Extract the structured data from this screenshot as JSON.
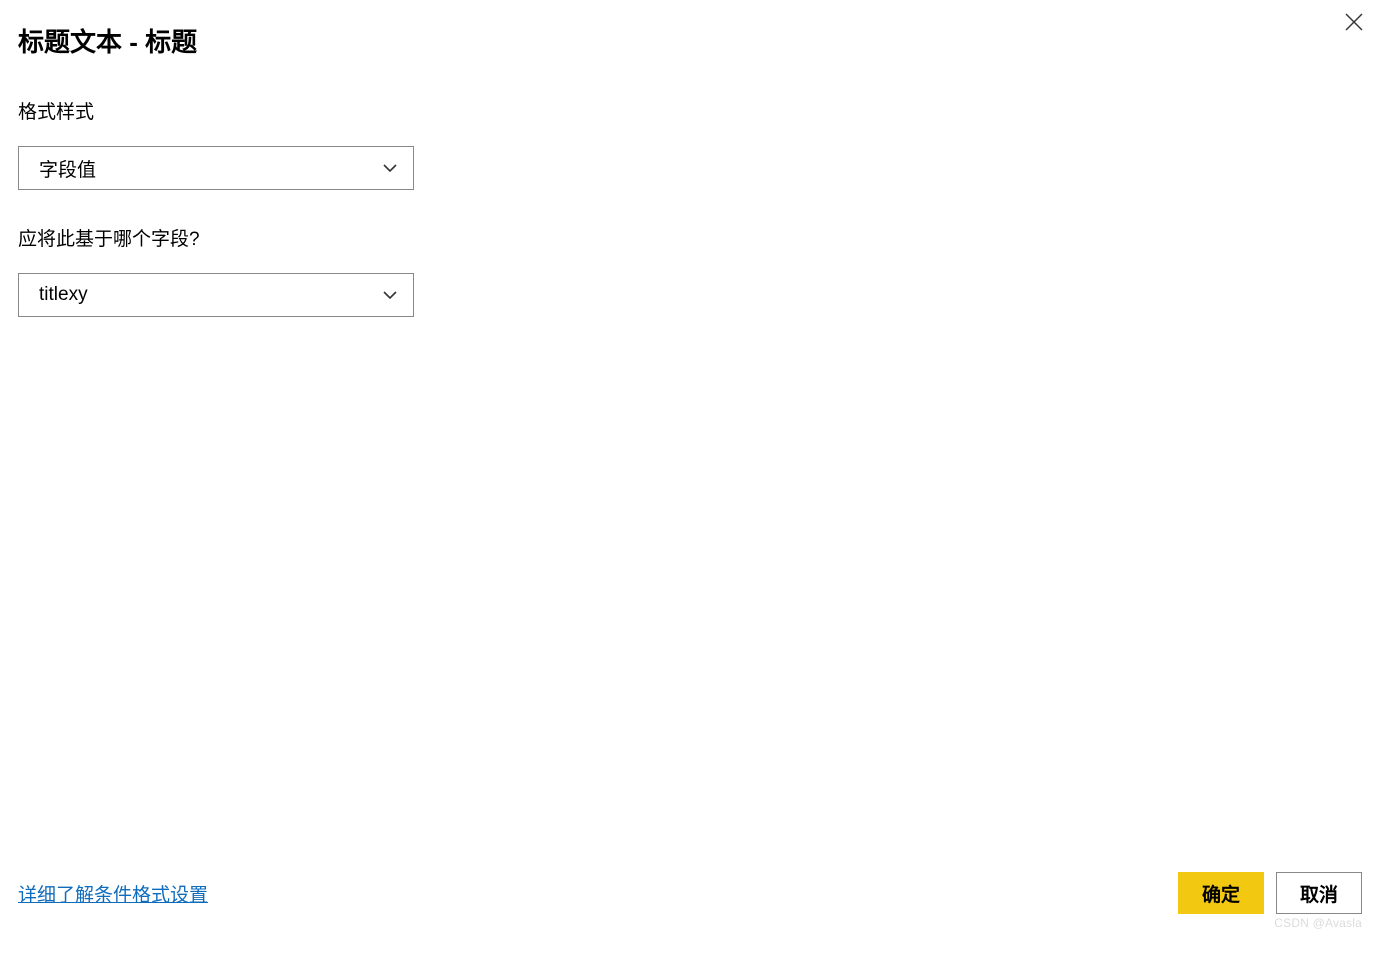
{
  "dialog": {
    "title": "标题文本 - 标题"
  },
  "fields": {
    "formatStyle": {
      "label": "格式样式",
      "value": "字段值"
    },
    "baseField": {
      "label": "应将此基于哪个字段?",
      "value": "titlexy"
    }
  },
  "footer": {
    "learnMore": "详细了解条件格式设置",
    "ok": "确定",
    "cancel": "取消"
  },
  "watermark": "CSDN @Avasla"
}
